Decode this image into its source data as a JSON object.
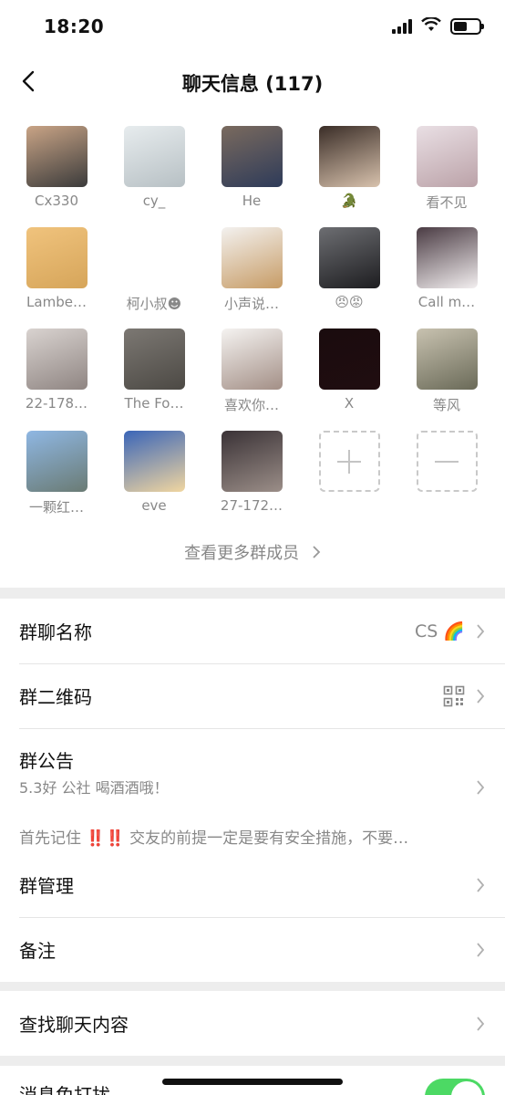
{
  "status_bar": {
    "time": "18:20"
  },
  "header": {
    "title": "聊天信息 (117)"
  },
  "members": [
    {
      "name": "Cx330",
      "colors": [
        "#c9a486",
        "#3b3b3b"
      ]
    },
    {
      "name": "cy_",
      "colors": [
        "#e7ecee",
        "#b7c0c4"
      ]
    },
    {
      "name": "He",
      "colors": [
        "#7a6a5e",
        "#2e3b59"
      ]
    },
    {
      "name": "🐊",
      "colors": [
        "#3a2d27",
        "#d8c2ad"
      ]
    },
    {
      "name": "看不见",
      "colors": [
        "#e9dfe4",
        "#bba2a8"
      ]
    },
    {
      "name": "Lambe…",
      "colors": [
        "#f0c37d",
        "#d6a55a"
      ]
    },
    {
      "name": "柯小叔☻",
      "colors": [
        "#ffffff",
        "#ffffff"
      ]
    },
    {
      "name": "小声说…",
      "colors": [
        "#f3f1ef",
        "#c79c66"
      ]
    },
    {
      "name": "😠😡",
      "colors": [
        "#6d6e72",
        "#1d1d20"
      ]
    },
    {
      "name": "Call m…",
      "colors": [
        "#4a3b43",
        "#f3eff0"
      ]
    },
    {
      "name": "22-178…",
      "colors": [
        "#d9d3d0",
        "#8f8582"
      ]
    },
    {
      "name": "The Fo…",
      "colors": [
        "#7c7873",
        "#4c4944"
      ]
    },
    {
      "name": "喜欢你…",
      "colors": [
        "#f5f3f1",
        "#a38f86"
      ]
    },
    {
      "name": "X",
      "colors": [
        "#1a0c0e",
        "#200d10"
      ]
    },
    {
      "name": "等风",
      "colors": [
        "#c8c2b0",
        "#6a6a58"
      ]
    },
    {
      "name": "一颗红…",
      "colors": [
        "#8fb7e3",
        "#6a7b74"
      ]
    },
    {
      "name": "eve",
      "colors": [
        "#3a65b8",
        "#f1d6a0"
      ]
    },
    {
      "name": "27-172…",
      "colors": [
        "#3a3236",
        "#9b8e88"
      ]
    }
  ],
  "actions": {
    "add_icon": "plus-icon",
    "remove_icon": "minus-icon"
  },
  "more_members": "查看更多群成员",
  "settings": {
    "group_name_label": "群聊名称",
    "group_name_value": "CS 🌈",
    "qr_label": "群二维码",
    "announcement_label": "群公告",
    "announcement_line1": "5.3好 公社 喝酒酒哦！",
    "announcement_line2": "首先记住 ‼️‼️ 交友的前提一定是要有安全措施，不要…",
    "manage_label": "群管理",
    "remark_label": "备注",
    "search_label": "查找聊天内容",
    "mute_label": "消息免打扰",
    "mute_on": true
  },
  "colors": {
    "toggle_on": "#4cd964",
    "background": "#ededed"
  }
}
